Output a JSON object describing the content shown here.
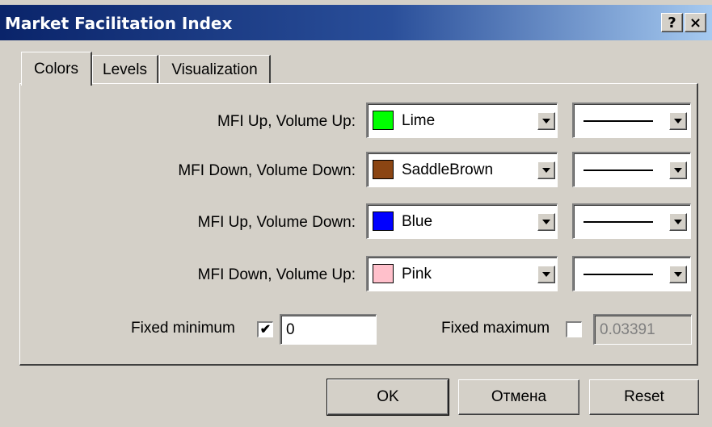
{
  "window": {
    "title": "Market Facilitation Index",
    "help_label": "?",
    "close_label": "×"
  },
  "tabs": [
    {
      "label": "Colors",
      "active": true
    },
    {
      "label": "Levels",
      "active": false
    },
    {
      "label": "Visualization",
      "active": false
    }
  ],
  "rows": [
    {
      "label": "MFI Up, Volume Up:",
      "color_name": "Lime",
      "color_hex": "#00ff00"
    },
    {
      "label": "MFI Down, Volume Down:",
      "color_name": "SaddleBrown",
      "color_hex": "#8b4513"
    },
    {
      "label": "MFI Up, Volume Down:",
      "color_name": "Blue",
      "color_hex": "#0000ff"
    },
    {
      "label": "MFI Down, Volume Up:",
      "color_name": "Pink",
      "color_hex": "#ffc0cb"
    }
  ],
  "fixed_min": {
    "label": "Fixed minimum",
    "checked": true,
    "value": "0"
  },
  "fixed_max": {
    "label": "Fixed maximum",
    "checked": false,
    "value": "0.03391"
  },
  "buttons": {
    "ok": "OK",
    "cancel": "Отмена",
    "reset": "Reset"
  }
}
